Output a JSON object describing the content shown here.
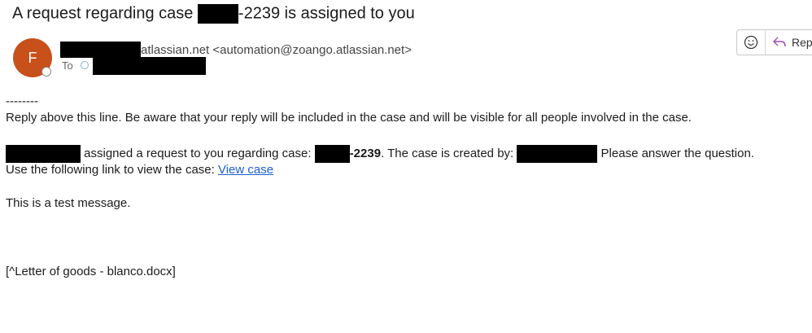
{
  "subject": {
    "before": "A request regarding case ",
    "after": "-2239 is assigned to you"
  },
  "sender": {
    "avatar_letter": "F",
    "address": "atlassian.net <automation@zoango.atlassian.net>",
    "to_label": "To"
  },
  "actions": {
    "reply_label": "Repl"
  },
  "body": {
    "separator": "--------",
    "notice": "Reply above this line. Be aware that your reply will be included in the case and will be visible for all people involved in the case.",
    "assigned_text": " assigned a request to you regarding case: ",
    "case_suffix": "-2239",
    "created_by_text": ". The case is created by: ",
    "please_answer": " Please answer the question.",
    "link_intro": "Use the following link to view the case: ",
    "link_label": "View case",
    "test_message": "This is a test message.",
    "attachment": "[^Letter of goods - blanco.docx]"
  },
  "colors": {
    "avatar": "#c8501a",
    "link": "#1a5fd0",
    "reply_arrow": "#9b4bb0"
  }
}
